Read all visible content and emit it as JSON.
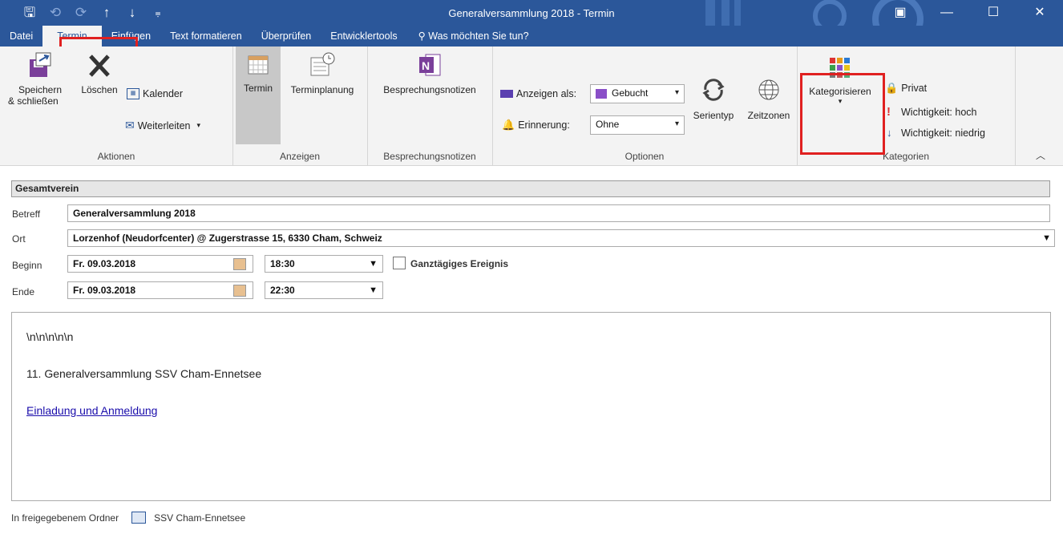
{
  "window": {
    "title": "Generalversammlung 2018  -  Termin",
    "minimize": "—",
    "maximize": "☐",
    "close": "✕",
    "restore_icon": "▣"
  },
  "qat": {
    "save": "🖫",
    "undo": "⟲",
    "redo": "⟳",
    "up": "↑",
    "down": "↓",
    "customize": "⩦"
  },
  "tabs": [
    "Datei",
    "Termin",
    "Einfügen",
    "Text formatieren",
    "Überprüfen",
    "Entwicklertools"
  ],
  "tell_me": "Was möchten Sie tun?",
  "ribbon": {
    "aktionen": {
      "label": "Aktionen",
      "save_close_1": "Speichern",
      "save_close_2": "& schließen",
      "delete": "Löschen",
      "calendar": "Kalender",
      "forward": "Weiterleiten"
    },
    "anzeigen": {
      "label": "Anzeigen",
      "termin": "Termin",
      "terminplanung": "Terminplanung"
    },
    "besprechung": {
      "label": "Besprechungsnotizen",
      "btn": "Besprechungsnotizen"
    },
    "optionen": {
      "label": "Optionen",
      "anzeigen_als": "Anzeigen als:",
      "anzeigen_als_value": "Gebucht",
      "erinnerung": "Erinnerung:",
      "erinnerung_value": "Ohne",
      "serientyp": "Serientyp",
      "zeitzonen": "Zeitzonen"
    },
    "kategorien": {
      "label": "Kategorien",
      "kategorisieren": "Kategorisieren",
      "privat": "Privat",
      "hoch": "Wichtigkeit: hoch",
      "niedrig": "Wichtigkeit: niedrig"
    }
  },
  "form": {
    "header": "Gesamtverein",
    "betreff_label": "Betreff",
    "betreff_value": "Generalversammlung 2018",
    "ort_label": "Ort",
    "ort_value": "Lorzenhof (Neudorfcenter) @ Zugerstrasse 15, 6330 Cham, Schweiz",
    "beginn_label": "Beginn",
    "beginn_date": "Fr. 09.03.2018",
    "beginn_time": "18:30",
    "allday": "Ganztägiges Ereignis",
    "ende_label": "Ende",
    "ende_date": "Fr. 09.03.2018",
    "ende_time": "22:30"
  },
  "body": {
    "line1": "\\n\\n\\n\\n\\n",
    "line2": "11. Generalversammlung SSV Cham-Ennetsee",
    "link": "Einladung und Anmeldung"
  },
  "footer": {
    "label": "In freigegebenem Ordner",
    "folder": "SSV Cham-Ennetsee"
  },
  "colors": {
    "accent": "#2b579a",
    "highlight": "#e02020",
    "link": "#1a0dab"
  }
}
